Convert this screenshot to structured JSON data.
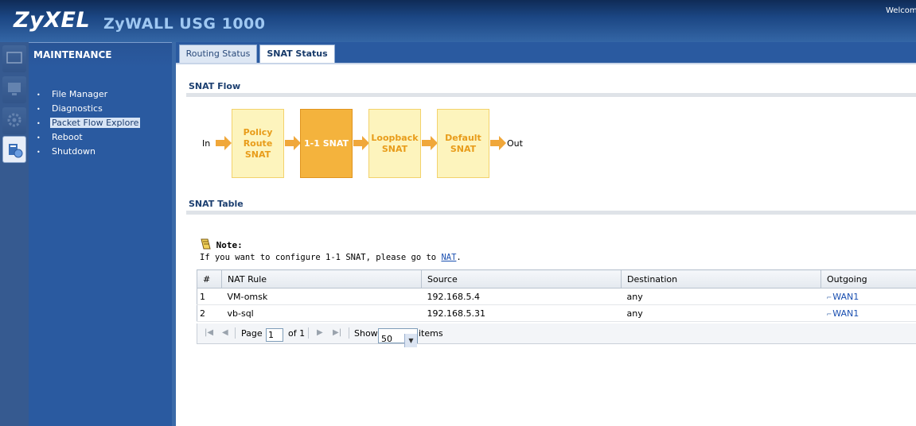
{
  "header": {
    "brand": "ZyXEL",
    "product": "ZyWALL USG 1000",
    "welcome": "Welcome"
  },
  "icon_strip": [
    "status-icon",
    "monitor-icon",
    "configuration-icon",
    "maintenance-icon"
  ],
  "menu": {
    "title": "MAINTENANCE",
    "items": [
      {
        "label": "File Manager"
      },
      {
        "label": "Diagnostics"
      },
      {
        "label": "Packet Flow Explore",
        "selected": true
      },
      {
        "label": "Reboot"
      },
      {
        "label": "Shutdown"
      }
    ]
  },
  "tabs": [
    {
      "label": "Routing Status"
    },
    {
      "label": "SNAT Status",
      "active": true
    }
  ],
  "snat_flow": {
    "title": "SNAT Flow",
    "in_label": "In",
    "out_label": "Out",
    "boxes": [
      {
        "label": "Policy Route SNAT"
      },
      {
        "label": "1-1 SNAT",
        "active": true
      },
      {
        "label": "Loopback SNAT"
      },
      {
        "label": "Default SNAT"
      }
    ]
  },
  "snat_table": {
    "title": "SNAT Table",
    "note_title": "Note:",
    "note_text_before": "If you want to configure 1-1 SNAT, please go to ",
    "note_link": "NAT",
    "note_text_after": ".",
    "columns": [
      "#",
      "NAT Rule",
      "Source",
      "Destination",
      "Outgoing"
    ],
    "rows": [
      {
        "num": "1",
        "rule": "VM-omsk",
        "source": "192.168.5.4",
        "destination": "any",
        "outgoing": "WAN1"
      },
      {
        "num": "2",
        "rule": "vb-sql",
        "source": "192.168.5.31",
        "destination": "any",
        "outgoing": "WAN1"
      }
    ],
    "pager": {
      "page_label": "Page",
      "page_value": "1",
      "of_label": "of 1",
      "show_label": "Show",
      "show_value": "50",
      "items_label": "items"
    }
  },
  "colors": {
    "header": "#1b4683",
    "menu": "#2a5aa0",
    "flow_box": "#fdf4bd",
    "flow_box_active": "#f4b33d",
    "arrow": "#f0a73a"
  }
}
